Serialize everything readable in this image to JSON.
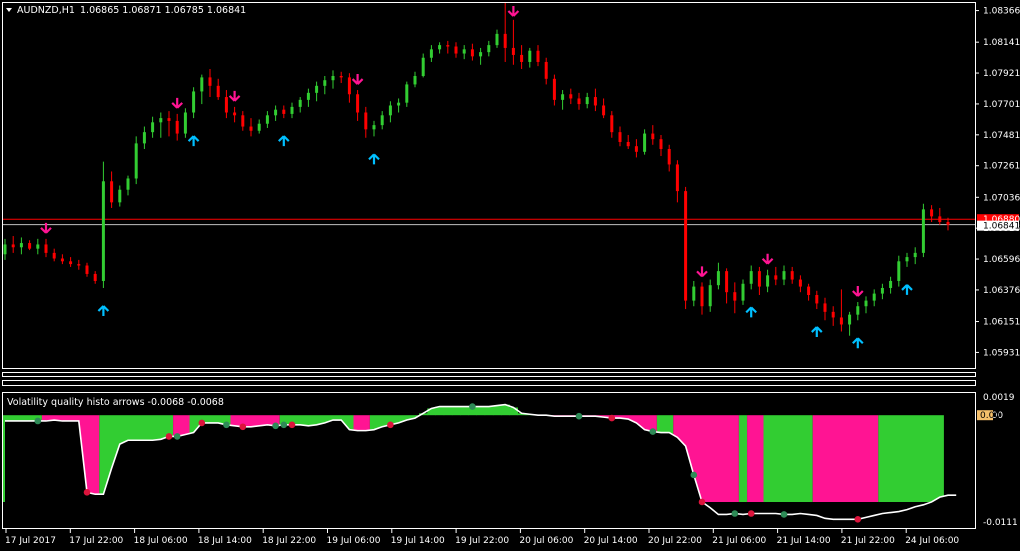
{
  "chart_header": {
    "menu_arrow": "triangle-down-icon",
    "symbol": "AUDNZD,H1",
    "ohlc": "1.06865 1.06871 1.06785 1.06841"
  },
  "price_axis": {
    "labels": [
      "1.08366",
      "1.08141",
      "1.07921",
      "1.07701",
      "1.07481",
      "1.07261",
      "1.07036",
      "1.06816",
      "1.06596",
      "1.06376",
      "1.06151",
      "1.05931"
    ],
    "current_price": "1.06841",
    "red_line_price": "1.06880"
  },
  "time_axis": {
    "labels": [
      "17 Jul 2017",
      "17 Jul 22:00",
      "18 Jul 06:00",
      "18 Jul 14:00",
      "18 Jul 22:00",
      "19 Jul 06:00",
      "19 Jul 14:00",
      "19 Jul 22:00",
      "20 Jul 06:00",
      "20 Jul 14:00",
      "20 Jul 22:00",
      "21 Jul 06:00",
      "21 Jul 14:00",
      "21 Jul 22:00",
      "24 Jul 06:00"
    ]
  },
  "indicator": {
    "title": "Volatility quality histo arrows -0.0068 -0.0068",
    "axis_labels": [
      "0.0019",
      "0.00",
      "-0.0111"
    ],
    "current_value": "0.00"
  },
  "colors": {
    "bull": "#32cd32",
    "bear": "#ff0000",
    "up_arrow": "#00bfff",
    "down_arrow": "#ff1493",
    "histo_pos": "#32cd32",
    "histo_neg": "#ff1493"
  },
  "chart_data": [
    {
      "type": "ohlc",
      "title": "AUDNZD,H1",
      "ylim": [
        1.0582,
        1.0842
      ],
      "bars": [
        [
          1.0663,
          1.0674,
          1.0659,
          1.067
        ],
        [
          1.067,
          1.0676,
          1.0664,
          1.0668
        ],
        [
          1.0668,
          1.0675,
          1.0663,
          1.0671
        ],
        [
          1.0671,
          1.0673,
          1.0666,
          1.0667
        ],
        [
          1.0667,
          1.0674,
          1.0663,
          1.067
        ],
        [
          1.067,
          1.0674,
          1.0661,
          1.0664
        ],
        [
          1.0664,
          1.0667,
          1.0658,
          1.066
        ],
        [
          1.066,
          1.0663,
          1.0656,
          1.0658
        ],
        [
          1.0658,
          1.0661,
          1.0654,
          1.0656
        ],
        [
          1.0656,
          1.0659,
          1.0652,
          1.0655
        ],
        [
          1.0655,
          1.0657,
          1.0647,
          1.0649
        ],
        [
          1.0649,
          1.0651,
          1.0642,
          1.0644
        ],
        [
          1.0644,
          1.0729,
          1.0639,
          1.0715
        ],
        [
          1.0715,
          1.0722,
          1.0696,
          1.07
        ],
        [
          1.07,
          1.0712,
          1.0697,
          1.0709
        ],
        [
          1.0709,
          1.0719,
          1.0705,
          1.0717
        ],
        [
          1.0717,
          1.0747,
          1.0713,
          1.0742
        ],
        [
          1.0742,
          1.0754,
          1.0738,
          1.075
        ],
        [
          1.075,
          1.0761,
          1.0746,
          1.0757
        ],
        [
          1.0757,
          1.0764,
          1.0746,
          1.076
        ],
        [
          1.076,
          1.0765,
          1.0747,
          1.0758
        ],
        [
          1.0758,
          1.0763,
          1.0744,
          1.0749
        ],
        [
          1.0749,
          1.0767,
          1.0746,
          1.0764
        ],
        [
          1.0764,
          1.0782,
          1.076,
          1.0779
        ],
        [
          1.0779,
          1.0791,
          1.077,
          1.0789
        ],
        [
          1.0789,
          1.0795,
          1.0775,
          1.0783
        ],
        [
          1.0783,
          1.0788,
          1.0773,
          1.0775
        ],
        [
          1.0775,
          1.078,
          1.076,
          1.0764
        ],
        [
          1.0764,
          1.0768,
          1.0757,
          1.0762
        ],
        [
          1.0762,
          1.0765,
          1.0751,
          1.0754
        ],
        [
          1.0754,
          1.076,
          1.0747,
          1.0751
        ],
        [
          1.0751,
          1.0759,
          1.0749,
          1.0756
        ],
        [
          1.0756,
          1.0765,
          1.0753,
          1.0762
        ],
        [
          1.0762,
          1.0769,
          1.0758,
          1.0766
        ],
        [
          1.0766,
          1.0769,
          1.076,
          1.0763
        ],
        [
          1.0763,
          1.0771,
          1.076,
          1.0768
        ],
        [
          1.0768,
          1.0775,
          1.0764,
          1.0773
        ],
        [
          1.0773,
          1.0781,
          1.0768,
          1.0778
        ],
        [
          1.0778,
          1.0786,
          1.0772,
          1.0783
        ],
        [
          1.0783,
          1.079,
          1.0777,
          1.0787
        ],
        [
          1.0787,
          1.0794,
          1.0781,
          1.079
        ],
        [
          1.079,
          1.0793,
          1.0785,
          1.0789
        ],
        [
          1.0789,
          1.0792,
          1.0771,
          1.0777
        ],
        [
          1.0777,
          1.078,
          1.0758,
          1.0764
        ],
        [
          1.0764,
          1.0768,
          1.0746,
          1.0752
        ],
        [
          1.0752,
          1.0758,
          1.0747,
          1.0755
        ],
        [
          1.0755,
          1.0765,
          1.0752,
          1.0762
        ],
        [
          1.0762,
          1.0772,
          1.0757,
          1.0769
        ],
        [
          1.0769,
          1.0774,
          1.0764,
          1.0771
        ],
        [
          1.0771,
          1.0786,
          1.0768,
          1.0784
        ],
        [
          1.0784,
          1.0793,
          1.0782,
          1.079
        ],
        [
          1.079,
          1.0806,
          1.0789,
          1.0803
        ],
        [
          1.0803,
          1.0812,
          1.08,
          1.0809
        ],
        [
          1.0809,
          1.0814,
          1.0806,
          1.0812
        ],
        [
          1.0812,
          1.0815,
          1.0806,
          1.0811
        ],
        [
          1.0811,
          1.0814,
          1.0803,
          1.0806
        ],
        [
          1.0806,
          1.0812,
          1.0802,
          1.0809
        ],
        [
          1.0809,
          1.0813,
          1.0801,
          1.0804
        ],
        [
          1.0804,
          1.081,
          1.0798,
          1.0807
        ],
        [
          1.0807,
          1.0815,
          1.0804,
          1.0812
        ],
        [
          1.0812,
          1.0823,
          1.081,
          1.082
        ],
        [
          1.082,
          1.0842,
          1.08,
          1.081
        ],
        [
          1.081,
          1.083,
          1.0798,
          1.0805
        ],
        [
          1.0805,
          1.0812,
          1.0795,
          1.08
        ],
        [
          1.08,
          1.081,
          1.0796,
          1.0808
        ],
        [
          1.0808,
          1.0812,
          1.0797,
          1.08
        ],
        [
          1.08,
          1.0803,
          1.0784,
          1.0788
        ],
        [
          1.0788,
          1.0791,
          1.0769,
          1.0773
        ],
        [
          1.0773,
          1.078,
          1.0766,
          1.0777
        ],
        [
          1.0777,
          1.0781,
          1.077,
          1.0774
        ],
        [
          1.0774,
          1.0778,
          1.0766,
          1.077
        ],
        [
          1.077,
          1.0778,
          1.0767,
          1.0775
        ],
        [
          1.0775,
          1.0781,
          1.0765,
          1.0769
        ],
        [
          1.0769,
          1.0774,
          1.076,
          1.0762
        ],
        [
          1.0762,
          1.0765,
          1.0746,
          1.075
        ],
        [
          1.075,
          1.0754,
          1.074,
          1.0743
        ],
        [
          1.0743,
          1.0748,
          1.0738,
          1.074
        ],
        [
          1.074,
          1.0745,
          1.0732,
          1.0736
        ],
        [
          1.0736,
          1.0752,
          1.0734,
          1.0749
        ],
        [
          1.0749,
          1.0755,
          1.0741,
          1.0745
        ],
        [
          1.0745,
          1.0748,
          1.0733,
          1.0738
        ],
        [
          1.0738,
          1.0741,
          1.0722,
          1.0727
        ],
        [
          1.0727,
          1.073,
          1.07,
          1.0708
        ],
        [
          1.0708,
          1.0711,
          1.0624,
          1.063
        ],
        [
          1.063,
          1.0644,
          1.0626,
          1.064
        ],
        [
          1.064,
          1.0643,
          1.062,
          1.0626
        ],
        [
          1.0626,
          1.0645,
          1.0622,
          1.0641
        ],
        [
          1.0641,
          1.0657,
          1.0638,
          1.0651
        ],
        [
          1.0651,
          1.0653,
          1.0628,
          1.0636
        ],
        [
          1.0636,
          1.0643,
          1.0621,
          1.063
        ],
        [
          1.063,
          1.0645,
          1.0627,
          1.0642
        ],
        [
          1.0642,
          1.0655,
          1.0638,
          1.0651
        ],
        [
          1.0651,
          1.0654,
          1.0634,
          1.064
        ],
        [
          1.064,
          1.0652,
          1.0636,
          1.0648
        ],
        [
          1.0648,
          1.0654,
          1.0641,
          1.0645
        ],
        [
          1.0645,
          1.0655,
          1.0641,
          1.0651
        ],
        [
          1.0651,
          1.0654,
          1.0642,
          1.0645
        ],
        [
          1.0645,
          1.0648,
          1.0636,
          1.064
        ],
        [
          1.064,
          1.0642,
          1.063,
          1.0634
        ],
        [
          1.0634,
          1.0637,
          1.0624,
          1.0628
        ],
        [
          1.0628,
          1.0632,
          1.0616,
          1.0622
        ],
        [
          1.0622,
          1.0626,
          1.0612,
          1.0618
        ],
        [
          1.0618,
          1.0638,
          1.0608,
          1.0613
        ],
        [
          1.0613,
          1.0622,
          1.0605,
          1.062
        ],
        [
          1.062,
          1.0629,
          1.0616,
          1.0626
        ],
        [
          1.0626,
          1.0633,
          1.0621,
          1.063
        ],
        [
          1.063,
          1.0638,
          1.0626,
          1.0635
        ],
        [
          1.0635,
          1.0642,
          1.0631,
          1.0639
        ],
        [
          1.0639,
          1.0647,
          1.0635,
          1.0644
        ],
        [
          1.0644,
          1.0662,
          1.064,
          1.0658
        ],
        [
          1.0658,
          1.0664,
          1.0654,
          1.0661
        ],
        [
          1.0661,
          1.0668,
          1.0656,
          1.0664
        ],
        [
          1.0664,
          1.0699,
          1.0661,
          1.0695
        ],
        [
          1.0695,
          1.0698,
          1.0686,
          1.069
        ],
        [
          1.069,
          1.0696,
          1.0684,
          1.0686
        ],
        [
          1.0686,
          1.0689,
          1.068,
          1.0684
        ]
      ],
      "up_arrows": [
        12,
        23,
        34,
        45,
        91,
        99,
        104,
        110
      ],
      "down_arrows": [
        5,
        21,
        28,
        43,
        62,
        85,
        93,
        104
      ]
    },
    {
      "type": "histogram",
      "title": "Volatility quality histo arrows",
      "ylim": [
        -0.0116,
        0.0022
      ],
      "segments": [
        {
          "from": 0,
          "to": 5,
          "sign": "pos"
        },
        {
          "from": 5,
          "to": 12,
          "sign": "neg"
        },
        {
          "from": 12,
          "to": 21,
          "sign": "pos"
        },
        {
          "from": 21,
          "to": 23,
          "sign": "neg"
        },
        {
          "from": 23,
          "to": 28,
          "sign": "pos"
        },
        {
          "from": 28,
          "to": 34,
          "sign": "neg"
        },
        {
          "from": 34,
          "to": 43,
          "sign": "pos"
        },
        {
          "from": 43,
          "to": 45,
          "sign": "neg"
        },
        {
          "from": 45,
          "to": 62,
          "sign": "pos"
        },
        {
          "from": 62,
          "to": 80,
          "sign": "neg"
        },
        {
          "from": 80,
          "to": 82,
          "sign": "pos"
        },
        {
          "from": 82,
          "to": 90,
          "sign": "neg"
        },
        {
          "from": 90,
          "to": 91,
          "sign": "pos"
        },
        {
          "from": 91,
          "to": 93,
          "sign": "neg"
        },
        {
          "from": 93,
          "to": 99,
          "sign": "pos"
        },
        {
          "from": 99,
          "to": 107,
          "sign": "neg"
        },
        {
          "from": 107,
          "to": 115,
          "sign": "pos"
        }
      ],
      "line": [
        -0.0006,
        -0.0006,
        -0.0006,
        -0.0006,
        -0.0006,
        -0.0006,
        -0.0005,
        -0.0006,
        -0.0006,
        -0.0006,
        -0.008,
        -0.0082,
        -0.0082,
        -0.0055,
        -0.003,
        -0.0026,
        -0.0026,
        -0.0026,
        -0.0026,
        -0.0025,
        -0.0022,
        -0.0022,
        -0.002,
        -0.0018,
        -0.0008,
        -0.0008,
        -0.0008,
        -0.001,
        -0.0011,
        -0.0012,
        -0.0012,
        -0.0011,
        -0.001,
        -0.0011,
        -0.001,
        -0.001,
        -0.001,
        -0.0011,
        -0.001,
        -0.0008,
        -0.0005,
        -0.0005,
        -0.0015,
        -0.0016,
        -0.0016,
        -0.0015,
        -0.0012,
        -0.001,
        -0.0008,
        -0.0005,
        -0.0003,
        0.0002,
        0.0007,
        0.0009,
        0.0009,
        0.0009,
        0.0009,
        0.0009,
        0.0009,
        0.0009,
        0.001,
        0.0011,
        0.0008,
        0.0002,
        0.0001,
        0.0,
        0.0,
        -0.0001,
        -0.0001,
        -0.0001,
        -0.0001,
        -0.0001,
        -0.0001,
        -0.0002,
        -0.0003,
        -0.0003,
        -0.0004,
        -0.0008,
        -0.0015,
        -0.0017,
        -0.0018,
        -0.0018,
        -0.0023,
        -0.0032,
        -0.0062,
        -0.009,
        -0.0096,
        -0.0103,
        -0.0103,
        -0.0102,
        -0.0103,
        -0.0102,
        -0.0102,
        -0.0102,
        -0.0102,
        -0.0103,
        -0.0103,
        -0.0102,
        -0.0103,
        -0.0104,
        -0.0107,
        -0.0108,
        -0.0108,
        -0.0108,
        -0.0108,
        -0.0106,
        -0.0104,
        -0.0102,
        -0.0101,
        -0.01,
        -0.0098,
        -0.0095,
        -0.0093,
        -0.009,
        -0.0085,
        -0.0083,
        -0.0083
      ],
      "green_dots": [
        4,
        21,
        27,
        33,
        34,
        57,
        70,
        79,
        84,
        89,
        95
      ],
      "red_dots": [
        10,
        20,
        24,
        29,
        35,
        47,
        74,
        85,
        91,
        104
      ]
    }
  ]
}
